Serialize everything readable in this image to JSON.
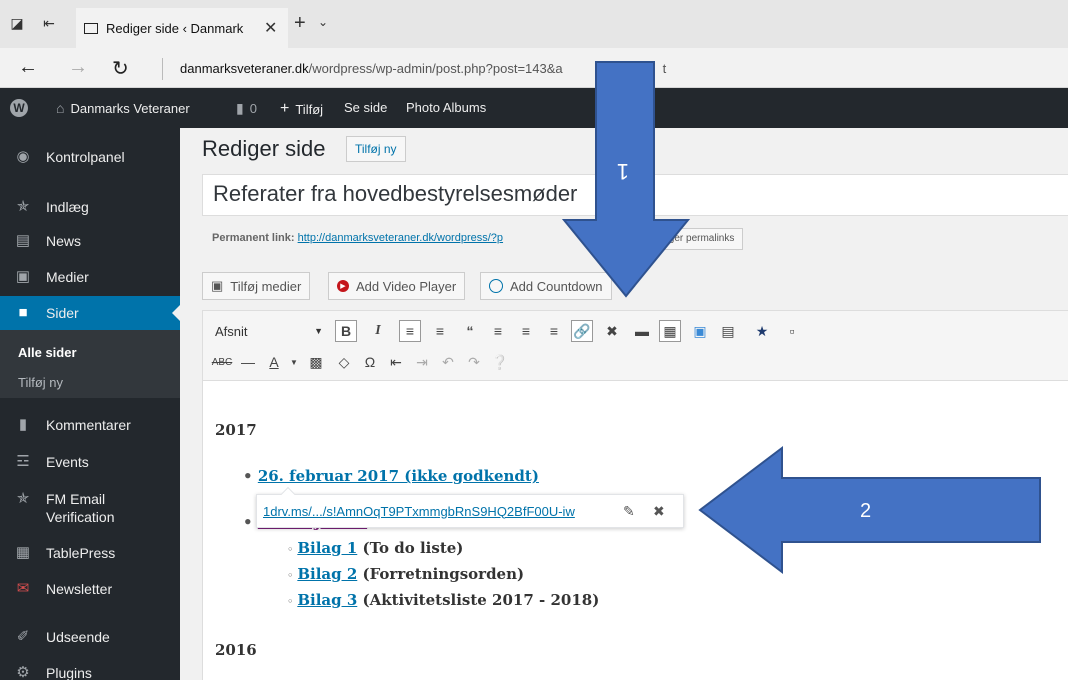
{
  "browser": {
    "tab_title": "Rediger side ‹ Danmark",
    "url_domain": "danmarksveteraner.dk",
    "url_path": "/wordpress/wp-admin/post.php?post=143&a",
    "url_suffix": "t"
  },
  "adminbar": {
    "site_name": "Danmarks Veteraner",
    "comments_count": "0",
    "add_new": "Tilføj",
    "view_page": "Se side",
    "photo_albums": "Photo Albums"
  },
  "sidebar": {
    "items": [
      {
        "label": "Kontrolpanel",
        "icon": "dashboard-icon"
      },
      {
        "label": "Indlæg",
        "icon": "pin-icon"
      },
      {
        "label": "News",
        "icon": "document-icon"
      },
      {
        "label": "Medier",
        "icon": "media-icon"
      },
      {
        "label": "Sider",
        "icon": "page-icon"
      },
      {
        "label": "Kommentarer",
        "icon": "comment-icon"
      },
      {
        "label": "Events",
        "icon": "events-icon"
      },
      {
        "label": "FM Email",
        "label2": "Verification",
        "icon": "pin-icon"
      },
      {
        "label": "TablePress",
        "icon": "table-icon"
      },
      {
        "label": "Newsletter",
        "icon": "mail-icon"
      },
      {
        "label": "Udseende",
        "icon": "brush-icon"
      },
      {
        "label": "Plugins",
        "icon": "plugin-icon"
      }
    ],
    "submenu": {
      "all_pages": "Alle sider",
      "add_new": "Tilføj ny"
    }
  },
  "main": {
    "page_title": "Rediger side",
    "add_new_button": "Tilføj ny",
    "post_title": "Referater fra hovedbestyrelsesmøder",
    "permalink_label": "Permanent link:",
    "permalink_url": "http://danmarksveteraner.dk/wordpress/?p",
    "edit_permalinks": "diger permalinks",
    "media_buttons": {
      "add_media": "Tilføj medier",
      "add_video": "Add Video Player",
      "add_countdown": "Add Countdown"
    },
    "toolbar": {
      "format": "Afsnit",
      "bold": "B",
      "italic": "I"
    }
  },
  "content": {
    "year_2017": "2017",
    "item_feb": "26. februar 2017 (ikke godkendt)",
    "item_may": "21. maj 2017",
    "bilag1_link": "Bilag 1",
    "bilag1_text": " (To do liste)",
    "bilag2_link": "Bilag 2",
    "bilag2_text": " (Forretningsorden)",
    "bilag3_link": "Bilag 3",
    "bilag3_text": " (Aktivitetsliste 2017 - 2018)",
    "year_2016": "2016"
  },
  "link_popup": {
    "url": "1drv.ms/.../s!AmnOqT9PTxmmgbRnS9HQ2BfF00U-iw"
  },
  "annotations": {
    "arrow1_label": "1",
    "arrow2_label": "2",
    "arrow_color": "#4472c4"
  }
}
